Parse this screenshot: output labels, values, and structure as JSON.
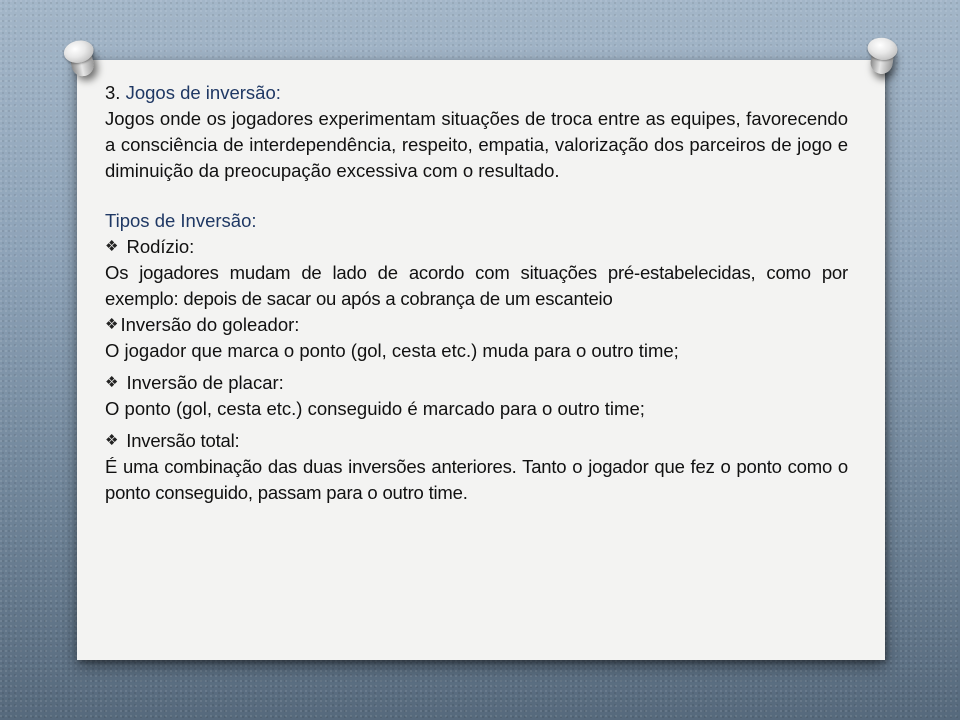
{
  "slide": {
    "heading_number": "3.",
    "heading_title": "Jogos de inversão:",
    "intro": "Jogos onde os jogadores experimentam situações de troca entre as equipes, favorecendo a consciência de interdependência, respeito, empatia, valorização dos parceiros de jogo e diminuição da preocupação excessiva com o resultado.",
    "types_heading": "Tipos de Inversão:",
    "bullet_icon": "diamond-four-bullet",
    "bullet_glyph": "❖",
    "items": [
      {
        "title": "Rodízio:",
        "text": "Os jogadores mudam de lado de acordo com situações pré-estabelecidas, como por exemplo: depois de sacar ou após a cobrança de um escanteio"
      },
      {
        "title": "Inversão do goleador:",
        "text": "O jogador que marca o ponto (gol, cesta etc.) muda para o outro time;"
      },
      {
        "title": "Inversão de placar:",
        "text": "O ponto (gol, cesta etc.) conseguido é marcado para o outro time;"
      },
      {
        "title": "Inversão total:",
        "text": "É uma combinação das duas inversões anteriores. Tanto o jogador que fez o ponto como o ponto conseguido, passam para o outro time."
      }
    ]
  },
  "colors": {
    "heading_blue": "#1f3864",
    "paper": "#f3f3f2",
    "background_top": "#a3b6c8",
    "background_bottom": "#56697c"
  }
}
